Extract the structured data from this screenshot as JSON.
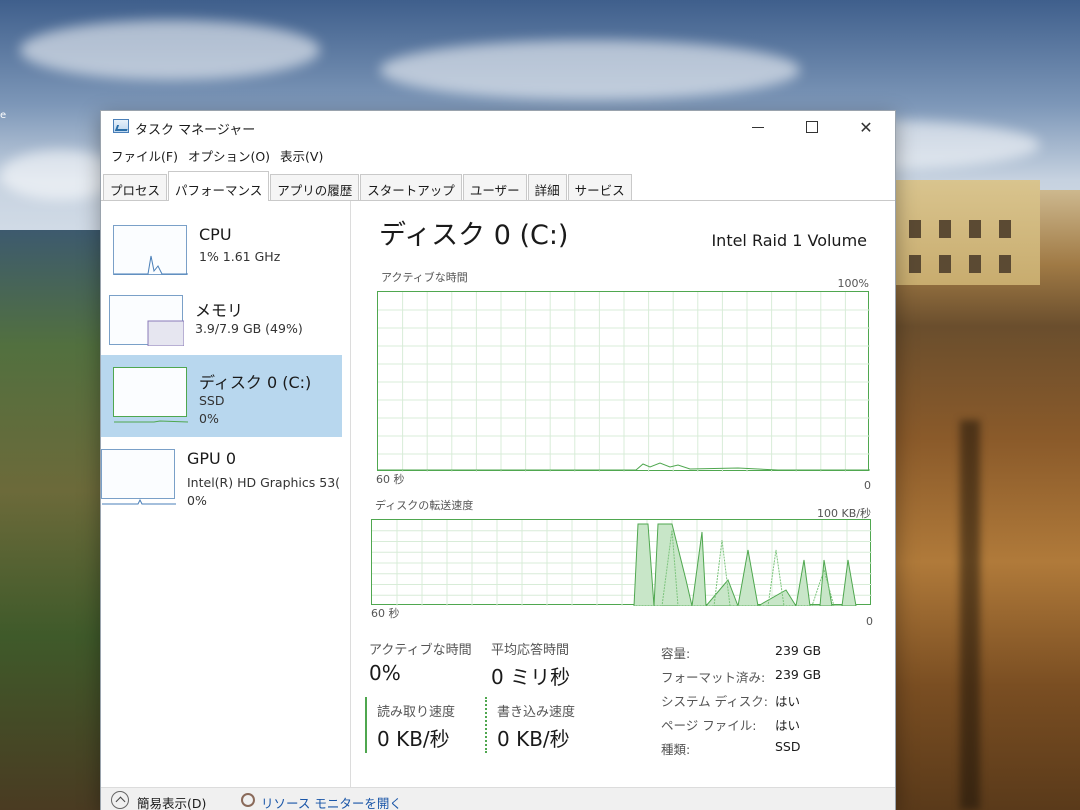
{
  "window": {
    "title": "タスク マネージャー",
    "menu": [
      "ファイル(F)",
      "オプション(O)",
      "表示(V)"
    ],
    "tabs": [
      {
        "label": "プロセス",
        "active": false
      },
      {
        "label": "パフォーマンス",
        "active": true
      },
      {
        "label": "アプリの履歴",
        "active": false
      },
      {
        "label": "スタートアップ",
        "active": false
      },
      {
        "label": "ユーザー",
        "active": false
      },
      {
        "label": "詳細",
        "active": false
      },
      {
        "label": "サービス",
        "active": false
      }
    ]
  },
  "sidebar": {
    "items": [
      {
        "name": "CPU",
        "line1": "1%  1.61 GHz",
        "line2": ""
      },
      {
        "name": "メモリ",
        "line1": "3.9/7.9 GB (49%)",
        "line2": ""
      },
      {
        "name": "ディスク 0 (C:)",
        "line1": "SSD",
        "line2": "0%"
      },
      {
        "name": "GPU 0",
        "line1": "Intel(R) HD Graphics 53(",
        "line2": "0%"
      }
    ],
    "memory_used_fraction": 0.49
  },
  "detail": {
    "title": "ディスク 0 (C:)",
    "model": "Intel Raid 1 Volume",
    "active_chart": {
      "label": "アクティブな時間",
      "max_label": "100%",
      "time_label": "60 秒",
      "min_label": "0"
    },
    "transfer_chart": {
      "label": "ディスクの転送速度",
      "max_label": "100 KB/秒",
      "time_label": "60 秒",
      "min_label": "0"
    },
    "stats": {
      "active_time_label": "アクティブな時間",
      "active_time_value": "0%",
      "avg_response_label": "平均応答時間",
      "avg_response_value": "0 ミリ秒",
      "read_label": "読み取り速度",
      "read_value": "0 KB/秒",
      "write_label": "書き込み速度",
      "write_value": "0 KB/秒"
    },
    "properties": [
      {
        "label": "容量:",
        "value": "239 GB"
      },
      {
        "label": "フォーマット済み:",
        "value": "239 GB"
      },
      {
        "label": "システム ディスク:",
        "value": "はい"
      },
      {
        "label": "ページ ファイル:",
        "value": "はい"
      },
      {
        "label": "種類:",
        "value": "SSD"
      }
    ]
  },
  "footer": {
    "fewer_details": "簡易表示(D)",
    "resource_monitor": "リソース モニターを開く"
  },
  "desktop": {
    "edge_text": "e"
  },
  "colors": {
    "accent_green": "#4fa74f",
    "selected_bg": "#b8d7ee",
    "thumb_border": "#7aa0c8",
    "link_blue": "#1a56a8"
  },
  "icons": [
    "app-icon",
    "minimize-icon",
    "maximize-icon",
    "close-icon",
    "chevron-up-icon",
    "resource-monitor-icon"
  ]
}
